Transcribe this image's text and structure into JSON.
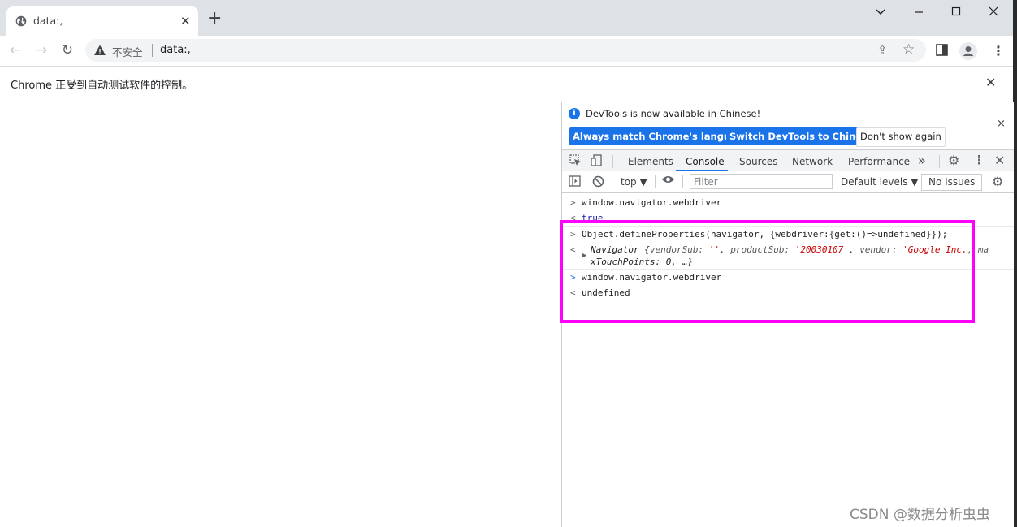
{
  "browser": {
    "tab_title": "data:,",
    "new_tab_symbol": "+",
    "tab_close_symbol": "✕",
    "insecure_label": "不安全",
    "url": "data:,",
    "infobar_message": "Chrome 正受到自动测试软件的控制。",
    "infobar_close": "✕"
  },
  "devtools": {
    "banner": {
      "message": "DevTools is now available in Chinese!",
      "buttons": [
        "Always match Chrome's language",
        "Switch DevTools to Chinese",
        "Don't show again"
      ],
      "close": "×"
    },
    "tabs": [
      "Elements",
      "Console",
      "Sources",
      "Network",
      "Performance"
    ],
    "active_tab": "Console",
    "more_tabs": "»",
    "console_toolbar": {
      "context": "top ▼",
      "filter_placeholder": "Filter",
      "levels": "Default levels ▼",
      "issues": "No Issues"
    },
    "console": {
      "prompt": ">",
      "result_prefix": "<",
      "entries": [
        {
          "input": "window.navigator.webdriver",
          "output": "true"
        },
        {
          "input": "Object.defineProperties(navigator, {webdriver:{get:()=>undefined}});"
        },
        {
          "input": "window.navigator.webdriver",
          "output": "undefined"
        }
      ],
      "navigator_object": {
        "name": "Navigator",
        "open": "{",
        "vendorSub_key": "vendorSub:",
        "vendorSub_val": "''",
        "productSub_key": "productSub:",
        "productSub_val": "'20030107'",
        "vendor_key": "vendor:",
        "vendor_val": "'Google Inc.",
        "line1_tail": ", ma",
        "line2": "xTouchPoints: 0, …}"
      }
    }
  },
  "watermark": "CSDN @数据分析虫虫",
  "colors": {
    "highlight": "#ff00ff",
    "accent": "#1a73e8"
  }
}
